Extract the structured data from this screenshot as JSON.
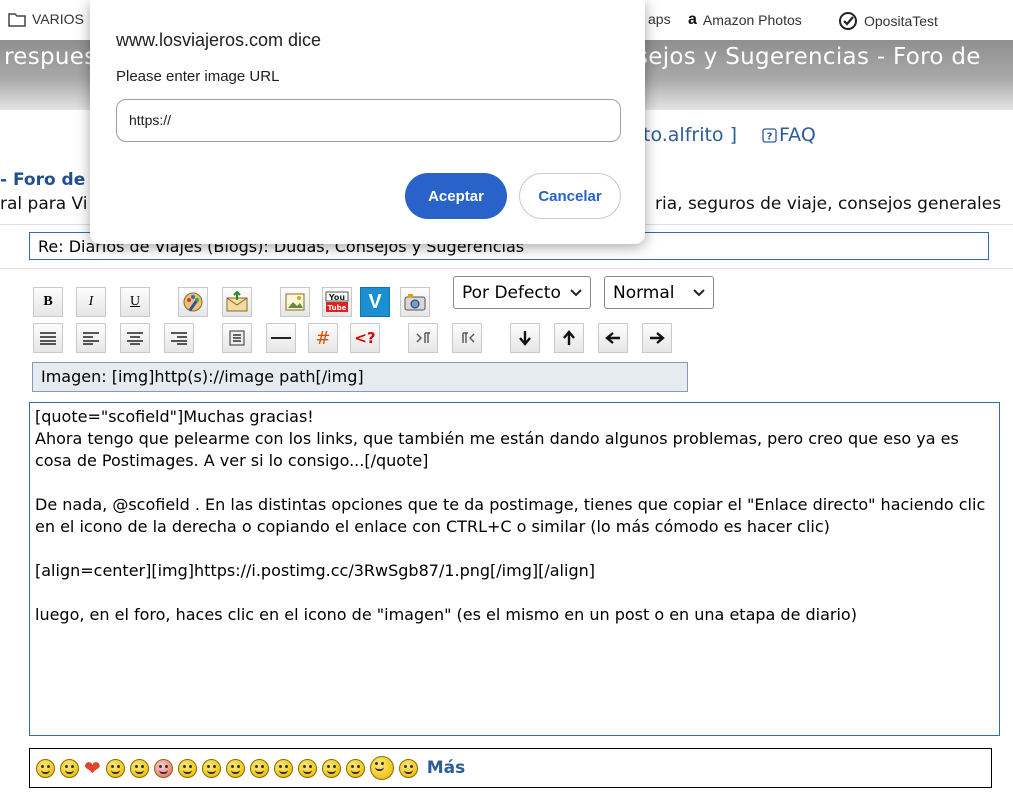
{
  "bookmarks": [
    {
      "label": "VARIOS",
      "icon": "folder-icon"
    },
    {
      "label": "aps",
      "icon": ""
    },
    {
      "label": "Amazon Photos",
      "icon": "amazon-icon"
    },
    {
      "label": "OpositaTest",
      "icon": "check-circle-icon"
    }
  ],
  "header": {
    "title_left": "respues",
    "title_right": "sejos y Sugerencias - Foro de"
  },
  "topnav": {
    "user_fragment": "to.alfrito ]",
    "faq": "FAQ"
  },
  "forum": {
    "title_fragment": "- Foro de",
    "desc_left": "ral para Vi",
    "desc_right": "ria, seguros de viaje, consejos generales"
  },
  "subject": "Re: Diarios de Viajes (Blogs): Dudas, Consejos y Sugerencias",
  "toolbar": {
    "row1": [
      "B",
      "I",
      "U",
      "color",
      "email",
      "image",
      "youtube",
      "vimeo",
      "camera"
    ],
    "font_select": "Por Defecto",
    "size_select": "Normal",
    "row2": [
      "justify",
      "align-left",
      "align-center",
      "align-right",
      "list",
      "hr",
      "#",
      "<?",
      "ltr",
      "rtl",
      "down",
      "up",
      "left",
      "right"
    ]
  },
  "help_line": "Imagen: [img]http(s)://image path[/img]",
  "message": "[quote=\"scofield\"]Muchas gracias!\nAhora tengo que pelearme con los links, que también me están dando algunos problemas, pero creo que eso ya es cosa de Postimages. A ver si lo consigo...[/quote]\n\nDe nada, @scofield . En las distintas opciones que te da postimage, tienes que copiar el \"Enlace directo\" haciendo clic en el icono de la derecha o copiando el enlace con CTRL+C o similar (lo más cómodo es hacer clic)\n\n[align=center][img]https://i.postimg.cc/3RwSgb87/1.png[/img][/align]\n\nluego, en el foro, haces clic en el icono de \"imagen\" (es el mismo en un post o en una etapa de diario)",
  "smilies_more": "Más",
  "dialog": {
    "title": "www.losviajeros.com dice",
    "message": "Please enter image URL",
    "input_value": "https://",
    "ok": "Aceptar",
    "cancel": "Cancelar",
    "accent": "#2962c8"
  }
}
